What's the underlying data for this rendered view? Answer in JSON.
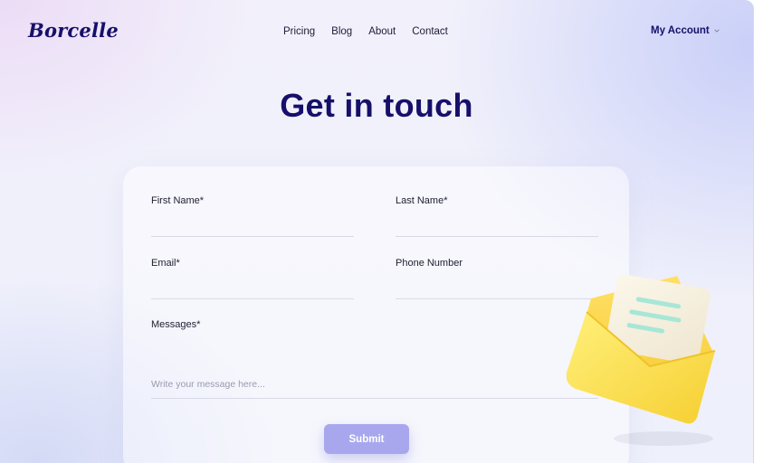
{
  "header": {
    "logo": "Borcelle",
    "nav": [
      "Pricing",
      "Blog",
      "About",
      "Contact"
    ],
    "account": "My Account"
  },
  "hero": {
    "title": "Get in touch"
  },
  "form": {
    "first_name_label": "First Name*",
    "last_name_label": "Last Name*",
    "email_label": "Email*",
    "phone_label": "Phone Number",
    "messages_label": "Messages*",
    "message_placeholder": "Write your message here...",
    "submit_label": "Submit"
  },
  "colors": {
    "brand_navy": "#16106a",
    "submit_button": "#a8a7ee",
    "envelope_yellow": "#ffd84a"
  },
  "icons": {
    "envelope": "envelope-letter-icon",
    "account_dropdown": "chevron-down-icon"
  }
}
